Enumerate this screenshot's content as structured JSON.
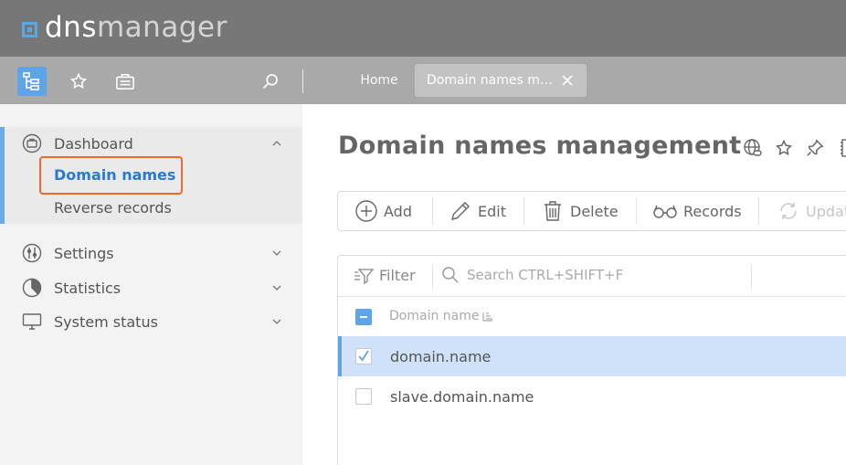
{
  "app": {
    "logo_part1": "dns",
    "logo_part2": "manager"
  },
  "toolbar": {
    "icons": [
      "tree-menu-icon",
      "star-icon",
      "briefcase-icon",
      "search-icon"
    ],
    "breadcrumb_home": "Home",
    "active_tab": "Domain names m…"
  },
  "sidebar": {
    "groups": [
      {
        "label": "Dashboard",
        "icon": "dashboard-icon",
        "expanded": true,
        "items": [
          {
            "label": "Domain names",
            "current": true
          },
          {
            "label": "Reverse records",
            "current": false
          }
        ]
      },
      {
        "label": "Settings",
        "icon": "settings-icon",
        "expanded": false
      },
      {
        "label": "Statistics",
        "icon": "pie-chart-icon",
        "expanded": false
      },
      {
        "label": "System status",
        "icon": "monitor-icon",
        "expanded": false
      }
    ]
  },
  "main": {
    "title": "Domain names management",
    "title_icons": [
      "globe-link-icon",
      "star-icon",
      "pin-icon",
      "book-icon"
    ],
    "actions": [
      {
        "label": "Add",
        "icon": "plus-circle-icon",
        "enabled": true
      },
      {
        "label": "Edit",
        "icon": "pencil-icon",
        "enabled": true
      },
      {
        "label": "Delete",
        "icon": "trash-icon",
        "enabled": true
      },
      {
        "label": "Records",
        "icon": "glasses-icon",
        "enabled": true
      },
      {
        "label": "Updat",
        "icon": "refresh-icon",
        "enabled": false
      }
    ],
    "filter_label": "Filter",
    "search_placeholder": "Search CTRL+SHIFT+F",
    "column_header": "Domain name",
    "rows": [
      {
        "name": "domain.name",
        "selected": true
      },
      {
        "name": "slave.domain.name",
        "selected": false
      }
    ]
  },
  "colors": {
    "header_bg": "#777777",
    "toolbar_bg": "#a9a9a9",
    "accent": "#5ea4e8",
    "highlight_border": "#ec6a2a",
    "selected_row": "#cfe2fa"
  }
}
